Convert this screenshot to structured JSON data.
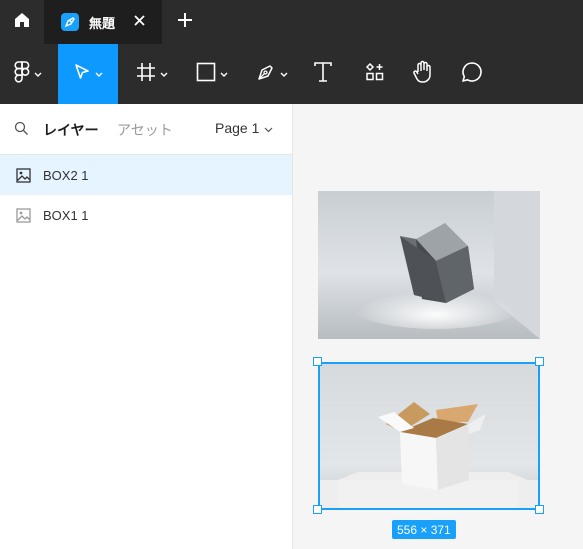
{
  "tabs": {
    "active_tab_title": "無題"
  },
  "toolbar": {
    "tools": [
      {
        "name": "main-menu",
        "icon": "figma-logo-icon",
        "has_caret": true
      },
      {
        "name": "move",
        "icon": "pointer-arrow-icon",
        "has_caret": true,
        "active": true
      },
      {
        "name": "frame",
        "icon": "frame-hash-icon",
        "has_caret": true
      },
      {
        "name": "shape",
        "icon": "rectangle-icon",
        "has_caret": true
      },
      {
        "name": "pen",
        "icon": "pen-tool-icon",
        "has_caret": true
      },
      {
        "name": "text",
        "icon": "text-t-icon",
        "has_caret": false
      },
      {
        "name": "resources",
        "icon": "resources-grid-icon",
        "has_caret": false
      },
      {
        "name": "hand",
        "icon": "hand-icon",
        "has_caret": false
      },
      {
        "name": "comment",
        "icon": "comment-bubble-icon",
        "has_caret": false
      }
    ]
  },
  "panel": {
    "layers_tab": "レイヤー",
    "assets_tab": "アセット",
    "page_selector": "Page 1"
  },
  "layers": [
    {
      "name": "BOX2 1",
      "selected": true
    },
    {
      "name": "BOX1 1",
      "selected": false
    }
  ],
  "canvas": {
    "selection_size": "556 × 371"
  },
  "colors": {
    "toolbar_bg": "#2c2c2c",
    "active_tab_bg": "#1e1e1e",
    "accent": "#18a0fb",
    "selected_row_bg": "#e5f4ff",
    "canvas_bg": "#f5f5f5"
  }
}
